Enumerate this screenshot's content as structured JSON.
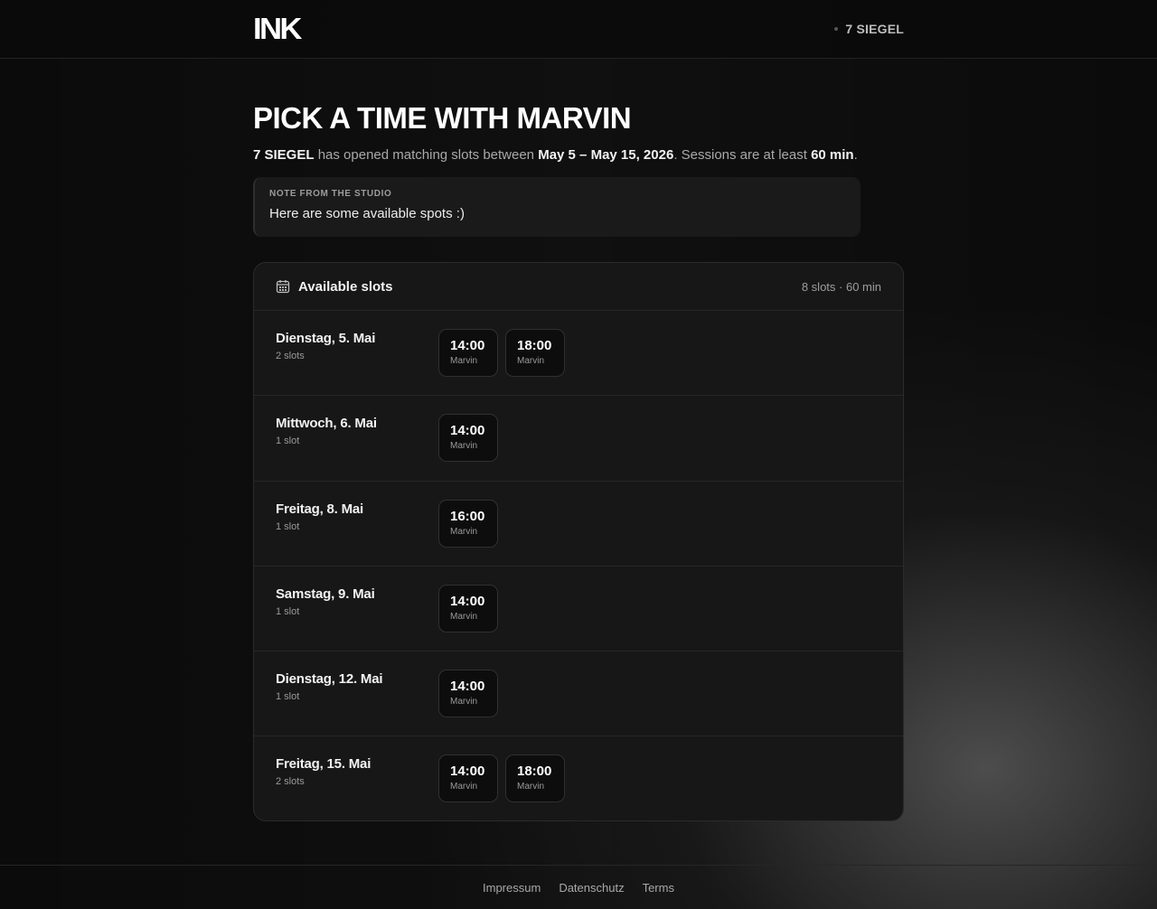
{
  "header": {
    "logo": "INK",
    "studio": "7 SIEGEL"
  },
  "page": {
    "title": "PICK A TIME WITH MARVIN",
    "subtitle": {
      "studio": "7 SIEGEL",
      "text1": " has opened matching slots between ",
      "range": "May 5 – May 15, 2026",
      "text2": ". Sessions are at least ",
      "duration": "60 min",
      "text3": "."
    }
  },
  "note": {
    "label": "NOTE FROM THE STUDIO",
    "text": "Here are some available spots :)"
  },
  "slots_card": {
    "title": "Available slots",
    "meta": "8 slots · 60 min",
    "days": [
      {
        "name": "Dienstag, 5. Mai",
        "count": "2 slots",
        "slots": [
          {
            "time": "14:00",
            "artist": "Marvin"
          },
          {
            "time": "18:00",
            "artist": "Marvin"
          }
        ]
      },
      {
        "name": "Mittwoch, 6. Mai",
        "count": "1 slot",
        "slots": [
          {
            "time": "14:00",
            "artist": "Marvin"
          }
        ]
      },
      {
        "name": "Freitag, 8. Mai",
        "count": "1 slot",
        "slots": [
          {
            "time": "16:00",
            "artist": "Marvin"
          }
        ]
      },
      {
        "name": "Samstag, 9. Mai",
        "count": "1 slot",
        "slots": [
          {
            "time": "14:00",
            "artist": "Marvin"
          }
        ]
      },
      {
        "name": "Dienstag, 12. Mai",
        "count": "1 slot",
        "slots": [
          {
            "time": "14:00",
            "artist": "Marvin"
          }
        ]
      },
      {
        "name": "Freitag, 15. Mai",
        "count": "2 slots",
        "slots": [
          {
            "time": "14:00",
            "artist": "Marvin"
          },
          {
            "time": "18:00",
            "artist": "Marvin"
          }
        ]
      }
    ]
  },
  "footer": {
    "links": [
      "Impressum",
      "Datenschutz",
      "Terms"
    ]
  }
}
